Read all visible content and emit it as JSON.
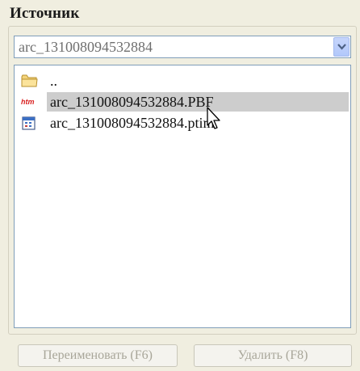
{
  "group": {
    "title": "Источник"
  },
  "combo": {
    "value": "arc_131008094532884"
  },
  "list": {
    "items": [
      {
        "label": "..",
        "icon": "folder-up-icon"
      },
      {
        "label": "arc_131008094532884.PBF",
        "icon": "htm-file-icon",
        "selected": true
      },
      {
        "label": "arc_131008094532884.ptim",
        "icon": "calendar-file-icon"
      }
    ]
  },
  "buttons": {
    "rename": "Переименовать (F6)",
    "delete": "Удалить (F8)"
  },
  "colors": {
    "background": "#ece9d8",
    "selection": "#cdcdcd",
    "field_border": "#7f9db9",
    "disabled_text": "#a8a699"
  }
}
